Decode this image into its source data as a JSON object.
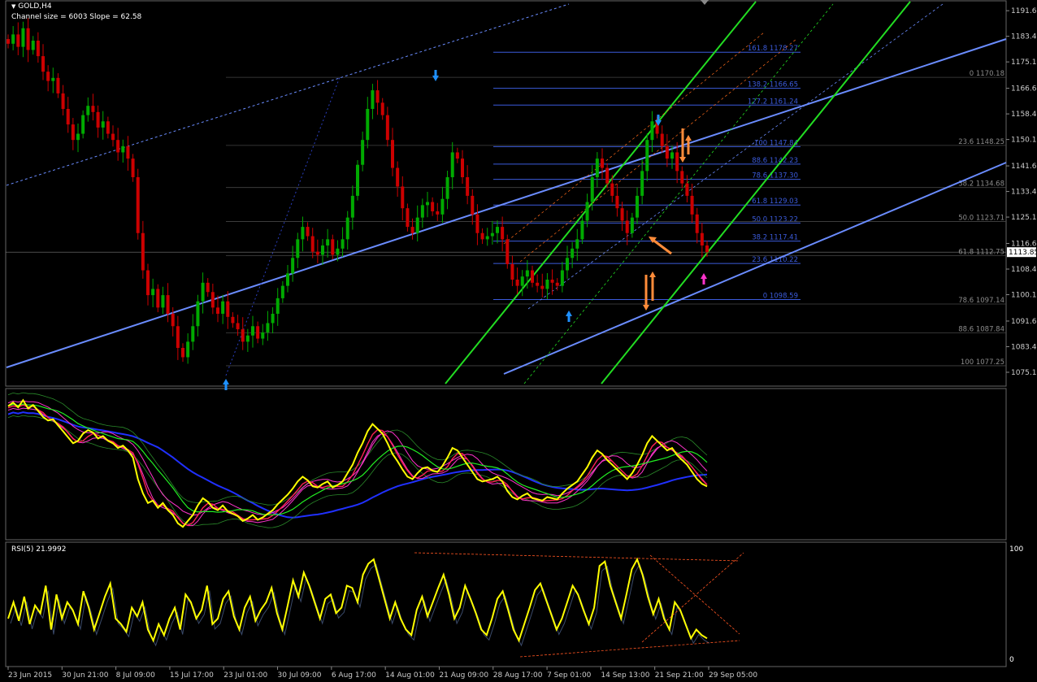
{
  "header": {
    "symbol_line": "GOLD,H4",
    "channel_line": "Channel size = 6003 Slope = 62.58"
  },
  "rsi_panel": {
    "label": "RSI(5) 21.9992",
    "scale_top": "100",
    "scale_bottom": "0"
  },
  "colors": {
    "background": "#000000",
    "bull_candle": "#00aa00",
    "bear_candle": "#cc0000",
    "fib_level": "#3b5bdb",
    "trend_blue": "#6a8cff",
    "channel_green": "#22dd22",
    "rsi_line": "#ffff00",
    "arrow_orange": "#ff8c3a",
    "arrow_cyan": "#1e90ff"
  },
  "chart_data": [
    {
      "type": "candlestick",
      "symbol": "GOLD",
      "timeframe": "H4",
      "y_axis_ticks": [
        "1191.65",
        "1183.40",
        "1175.15",
        "1166.65",
        "1158.40",
        "1150.15",
        "1141.65",
        "1133.40",
        "1125.15",
        "1116.65",
        "1108.40",
        "1100.15",
        "1091.65",
        "1083.40",
        "1075.15"
      ],
      "ylim": [
        1072.0,
        1193.0
      ],
      "current_price": "1113.85",
      "x_axis_ticks": [
        "23 Jun 2015",
        "30 Jun 21:00",
        "8 Jul 09:00",
        "15 Jul 17:00",
        "23 Jul 01:00",
        "30 Jul 09:00",
        "6 Aug 17:00",
        "14 Aug 01:00",
        "21 Aug 09:00",
        "28 Aug 17:00",
        "7 Sep 01:00",
        "14 Sep 13:00",
        "21 Sep 21:00",
        "29 Sep 05:00"
      ],
      "close_path": [
        1181,
        1184,
        1180,
        1186,
        1179,
        1182,
        1177,
        1172,
        1169,
        1170,
        1165,
        1160,
        1155,
        1150,
        1152,
        1158,
        1161,
        1159,
        1154,
        1156,
        1152,
        1150,
        1146,
        1148,
        1144,
        1138,
        1120,
        1108,
        1100,
        1102,
        1096,
        1100,
        1094,
        1090,
        1083,
        1080,
        1085,
        1090,
        1098,
        1104,
        1101,
        1096,
        1094,
        1098,
        1093,
        1091,
        1089,
        1085,
        1087,
        1090,
        1086,
        1088,
        1091,
        1094,
        1099,
        1103,
        1107,
        1112,
        1118,
        1122,
        1119,
        1114,
        1113,
        1116,
        1118,
        1113,
        1115,
        1118,
        1125,
        1132,
        1142,
        1150,
        1160,
        1166,
        1162,
        1158,
        1150,
        1141,
        1135,
        1128,
        1122,
        1120,
        1125,
        1129,
        1130,
        1127,
        1126,
        1131,
        1138,
        1146,
        1144,
        1138,
        1132,
        1126,
        1120,
        1118,
        1119,
        1120,
        1122,
        1118,
        1110,
        1105,
        1103,
        1106,
        1108,
        1104,
        1103,
        1102,
        1105,
        1104,
        1103,
        1108,
        1112,
        1115,
        1118,
        1124,
        1130,
        1138,
        1144,
        1141,
        1136,
        1132,
        1128,
        1124,
        1120,
        1125,
        1132,
        1140,
        1150,
        1156,
        1152,
        1148,
        1144,
        1146,
        1140,
        1136,
        1132,
        1126,
        1120,
        1116,
        1113.85
      ],
      "fibonacci_left_labels": [
        "161.8 1178.27",
        "138.2 1166.65",
        "127.2 1161.24",
        "100 1147.84",
        "88.6 1142.23",
        "78.6 1137.30",
        "61.8 1129.03",
        "50.0 1123.22",
        "38.2 1117.41",
        "23.6 1110.22",
        "0 1098.59"
      ],
      "fibonacci_left_values": [
        1178.27,
        1166.65,
        1161.24,
        1147.84,
        1142.23,
        1137.3,
        1129.03,
        1123.22,
        1117.41,
        1110.22,
        1098.59
      ],
      "fibonacci_right_labels": [
        "0 1170.18",
        "23.6 1148.25",
        "38.2 1134.68",
        "50.0 1123.71",
        "61.8 1112.75",
        "78.6 1097.14",
        "88.6 1087.84",
        "100 1077.25"
      ],
      "fibonacci_right_values": [
        1170.18,
        1148.25,
        1134.68,
        1123.71,
        1112.75,
        1097.14,
        1087.84,
        1077.25
      ]
    },
    {
      "type": "line",
      "name": "RSI(5)",
      "ylim": [
        0,
        100
      ],
      "values": [
        40,
        55,
        38,
        60,
        35,
        52,
        45,
        70,
        30,
        62,
        40,
        55,
        48,
        35,
        65,
        50,
        30,
        45,
        60,
        72,
        40,
        35,
        28,
        50,
        42,
        55,
        30,
        20,
        35,
        25,
        40,
        50,
        30,
        62,
        55,
        40,
        48,
        70,
        35,
        40,
        58,
        65,
        42,
        30,
        50,
        60,
        38,
        48,
        55,
        68,
        45,
        30,
        52,
        75,
        60,
        82,
        70,
        55,
        40,
        58,
        62,
        45,
        50,
        70,
        68,
        55,
        80,
        90,
        94,
        76,
        58,
        40,
        55,
        40,
        30,
        25,
        48,
        60,
        42,
        55,
        68,
        80,
        62,
        40,
        50,
        70,
        58,
        45,
        30,
        25,
        40,
        58,
        65,
        48,
        30,
        20,
        35,
        50,
        66,
        72,
        58,
        44,
        30,
        40,
        55,
        70,
        62,
        48,
        35,
        50,
        88,
        92,
        70,
        55,
        40,
        62,
        85,
        94,
        80,
        60,
        44,
        58,
        40,
        30,
        55,
        48,
        35,
        22,
        30,
        25,
        21.9992
      ]
    }
  ]
}
